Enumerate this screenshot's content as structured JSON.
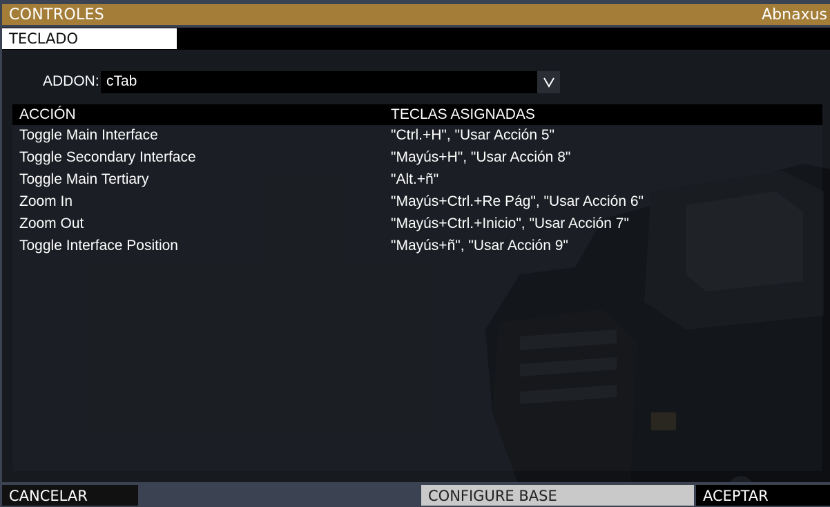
{
  "window": {
    "title": "CONTROLES",
    "user": "Abnaxus"
  },
  "tabs": [
    {
      "label": "TECLADO",
      "active": true
    }
  ],
  "addon": {
    "label": "ADDON:",
    "value": "cTab",
    "dropdown_icon": "chevron-down-icon"
  },
  "table": {
    "headers": [
      "ACCIÓN",
      "TECLAS ASIGNADAS"
    ],
    "rows": [
      {
        "action": "Toggle Main Interface",
        "keys": "\"Ctrl.+H\", \"Usar Acción 5\""
      },
      {
        "action": "Toggle Secondary Interface",
        "keys": "\"Mayús+H\", \"Usar Acción 8\""
      },
      {
        "action": "Toggle Main Tertiary",
        "keys": "\"Alt.+ñ\""
      },
      {
        "action": "Zoom In",
        "keys": "\"Mayús+Ctrl.+Re Pág\", \"Usar Acción 6\""
      },
      {
        "action": "Zoom Out",
        "keys": "\"Mayús+Ctrl.+Inicio\", \"Usar Acción 7\""
      },
      {
        "action": "Toggle Interface Position",
        "keys": "\"Mayús+ñ\", \"Usar Acción 9\""
      }
    ]
  },
  "footer": {
    "cancel": "CANCELAR",
    "configure_base": "CONFIGURE BASE",
    "accept": "ACEPTAR"
  },
  "colors": {
    "title_bar": "#a47e38",
    "panel": "#171a1f",
    "frame": "#3b4352"
  }
}
